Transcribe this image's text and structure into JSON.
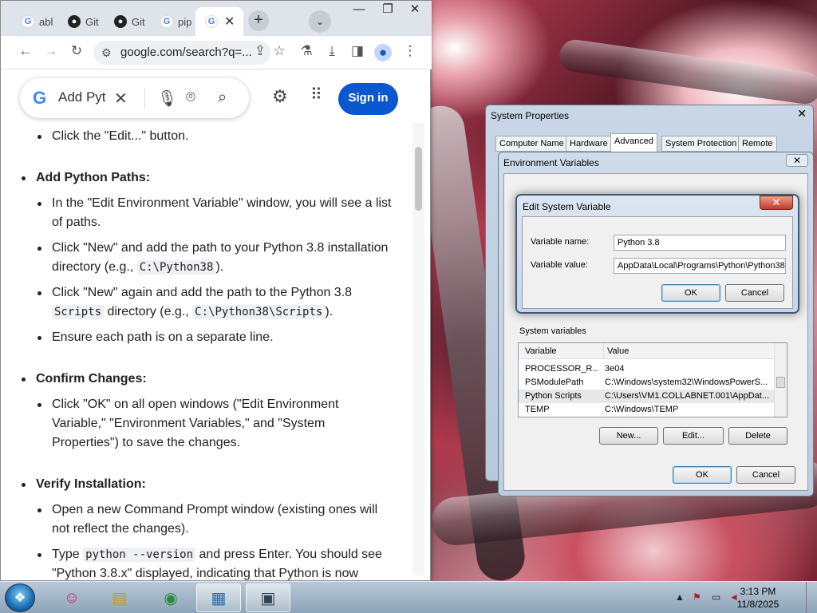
{
  "browser": {
    "tabs": [
      {
        "label": "abl",
        "icon": "google-icon"
      },
      {
        "label": "Git",
        "icon": "github-icon"
      },
      {
        "label": "Git",
        "icon": "github-icon"
      },
      {
        "label": "pip",
        "icon": "google-icon"
      },
      {
        "label": "",
        "icon": "google-icon",
        "active": true
      }
    ],
    "url": "google.com/search?q=...",
    "search_query": "Add Pyt",
    "signin_label": "Sign in"
  },
  "content": {
    "line_edit": "Click the \"Edit...\" button.",
    "add_paths_heading": "Add Python Paths:",
    "add1_a": "In the \"Edit Environment Variable\" window, you will see a list",
    "add1_b": "of paths.",
    "add2_a": "Click \"New\" and add the path to your Python 3.8 installation",
    "add2_b_pre": "directory (e.g., ",
    "add2_b_code": "C:\\Python38",
    "add2_b_post": ").",
    "add3_a": "Click \"New\" again and add the path to the Python 3.8",
    "add3_b_code1": "Scripts",
    "add3_b_mid": " directory (e.g., ",
    "add3_b_code2": "C:\\Python38\\Scripts",
    "add3_b_post": ").",
    "add4": "Ensure each path is on a separate line.",
    "confirm_heading": "Confirm Changes:",
    "confirm1_a": "Click \"OK\" on all open windows (\"Edit Environment",
    "confirm1_b": "Variable,\" \"Environment Variables,\" and \"System",
    "confirm1_c": "Properties\") to save the changes.",
    "verify_heading": "Verify Installation:",
    "verify1_a": "Open a new Command Prompt window (existing ones will",
    "verify1_b": "not reflect the changes).",
    "verify2_pre": "Type ",
    "verify2_code": "python --version",
    "verify2_post": " and press Enter. You should see",
    "verify2_b": "\"Python 3.8.x\" displayed, indicating that Python is now"
  },
  "system_properties": {
    "title": "System Properties",
    "tabs": [
      "Computer Name",
      "Hardware",
      "Advanced",
      "System Protection",
      "Remote"
    ],
    "active_tab": "Advanced"
  },
  "env_vars": {
    "title": "Environment Variables",
    "system_vars_label": "System variables",
    "columns": [
      "Variable",
      "Value"
    ],
    "rows": [
      {
        "variable": "PROCESSOR_R...",
        "value": "3e04"
      },
      {
        "variable": "PSModulePath",
        "value": "C:\\Windows\\system32\\WindowsPowerS..."
      },
      {
        "variable": "Python Scripts",
        "value": "C:\\Users\\VM1.COLLABNET.001\\AppDat..."
      },
      {
        "variable": "TEMP",
        "value": "C:\\Windows\\TEMP"
      }
    ],
    "new_label": "New...",
    "edit_label": "Edit...",
    "delete_label": "Delete",
    "ok_label": "OK",
    "cancel_label": "Cancel"
  },
  "edit_var": {
    "title": "Edit System Variable",
    "name_label": "Variable name:",
    "name_value": "Python 3.8",
    "value_label": "Variable value:",
    "value_value": "AppData\\Local\\Programs\\Python\\Python38",
    "ok_label": "OK",
    "cancel_label": "Cancel"
  },
  "taskbar": {
    "time": "3:13 PM",
    "date": "11/8/2025"
  }
}
